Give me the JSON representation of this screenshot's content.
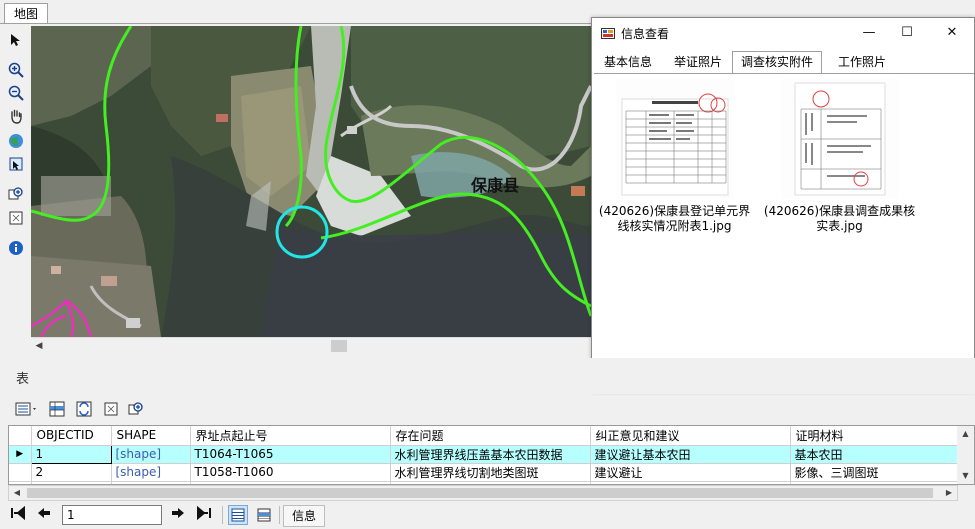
{
  "map_tab": "地图",
  "map": {
    "label": "保康县"
  },
  "dialog": {
    "title": "信息查看",
    "controls": {
      "minimize": "—",
      "maximize": "☐",
      "close": "✕"
    },
    "tabs": [
      "基本信息",
      "举证照片",
      "调查核实附件",
      "工作照片"
    ],
    "active_tab": 2,
    "files": [
      {
        "caption": "(420626)保康县登记单元界线核实情况附表1.jpg"
      },
      {
        "caption": "(420626)保康县调查成果核实表.jpg"
      }
    ]
  },
  "table_panel": {
    "title": "表",
    "columns": [
      "OBJECTID",
      "SHAPE",
      "界址点起止号",
      "存在问题",
      "纠正意见和建议",
      "证明材料"
    ],
    "rows": [
      [
        "1",
        "[shape]",
        "T1064-T1065",
        "水利管理界线压盖基本农田数据",
        "建议避让基本农田",
        "基本农田"
      ],
      [
        "2",
        "[shape]",
        "T1058-T1060",
        "水利管理界线切割地类图斑",
        "建议避让",
        "影像、三调图斑"
      ]
    ],
    "selected_row": 0
  },
  "navigator": {
    "current_record": "1",
    "info_tab": "信息"
  },
  "colors": {
    "boundary_green": "#44ee22",
    "selection_cyan": "#22e6e6",
    "magenta_line": "#ff22cc",
    "selected_row": "#b7ffff"
  }
}
